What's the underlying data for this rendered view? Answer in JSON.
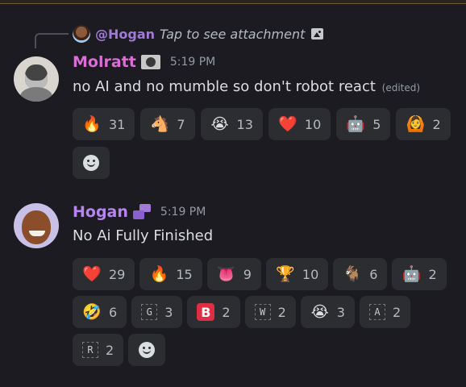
{
  "reply": {
    "username": "@Hogan",
    "preview_text": "Tap to see attachment",
    "attachment_icon": "image-icon"
  },
  "messages": [
    {
      "username": "Molratt",
      "username_color": "#d96ed4",
      "badge_icon": "user-badge-icon",
      "timestamp": "5:19 PM",
      "text": "no AI and no mumble so don't robot react",
      "edited_label": "(edited)",
      "reactions": [
        {
          "emoji": "🔥",
          "count": "31",
          "icon": "fire-icon"
        },
        {
          "emoji": "🐴",
          "count": "7",
          "icon": "horse-icon"
        },
        {
          "emoji": "😭",
          "count": "13",
          "icon": "custom-crying-face-icon"
        },
        {
          "emoji": "❤️",
          "count": "10",
          "icon": "heart-icon"
        },
        {
          "emoji": "🤖",
          "count": "5",
          "icon": "robot-icon"
        },
        {
          "emoji": "🙆",
          "count": "2",
          "icon": "person-raising-arms-icon"
        }
      ]
    },
    {
      "username": "Hogan",
      "username_color": "#b785ef",
      "role_icon": "role-icon",
      "timestamp": "5:19 PM",
      "text": "No Ai Fully Finished",
      "reactions": [
        {
          "emoji": "❤️",
          "count": "29",
          "icon": "heart-icon"
        },
        {
          "emoji": "🔥",
          "count": "15",
          "icon": "fire-icon"
        },
        {
          "emoji": "👅",
          "count": "9",
          "icon": "tongue-icon"
        },
        {
          "emoji": "🏆",
          "count": "10",
          "icon": "trophy-icon"
        },
        {
          "emoji": "🐐",
          "count": "6",
          "icon": "goat-icon"
        },
        {
          "emoji": "🤖",
          "count": "2",
          "icon": "robot-icon"
        },
        {
          "emoji": "🤣",
          "count": "6",
          "icon": "rolling-laughing-icon"
        },
        {
          "emoji": "G",
          "count": "3",
          "icon": "letter-g-icon"
        },
        {
          "emoji": "B",
          "count": "2",
          "icon": "b-button-icon"
        },
        {
          "emoji": "W",
          "count": "2",
          "icon": "letter-w-icon"
        },
        {
          "emoji": "😭",
          "count": "3",
          "icon": "custom-crying-face-icon"
        },
        {
          "emoji": "A",
          "count": "2",
          "icon": "letter-a-icon"
        },
        {
          "emoji": "R",
          "count": "2",
          "icon": "letter-r-icon"
        }
      ]
    }
  ]
}
